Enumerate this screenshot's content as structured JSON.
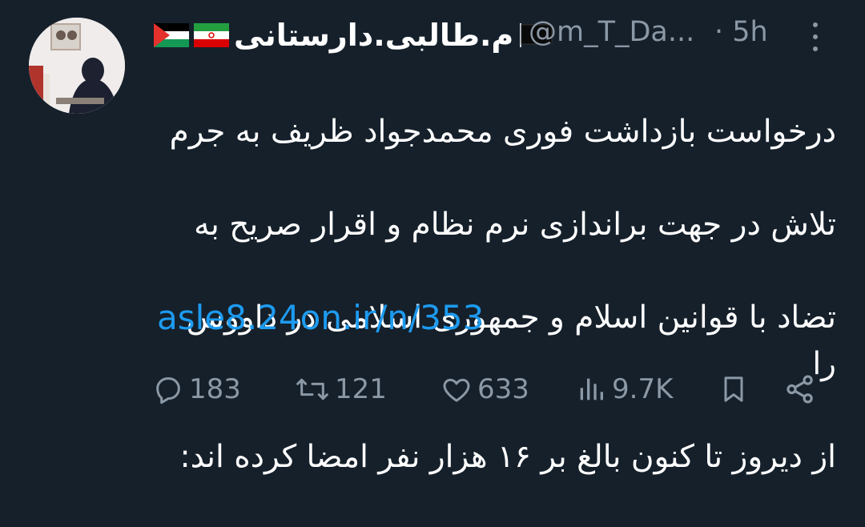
{
  "tweet": {
    "display_name": "م.طالبی.دارستانی",
    "handle": "@m_T_Da...",
    "time": "· 5h",
    "text_lines": [
      "درخواست بازداشت فوری محمدجواد ظریف به جرم",
      "تلاش در جهت براندازی نرم نظام و اقرار صریح به",
      "تضاد با قوانین اسلام و جمهوری اسلامی در داووس را",
      "از دیروز تا کنون بالغ بر ۱۶ هزار نفر امضا کرده اند:"
    ],
    "link": "asle8.24on.ir/n/353"
  },
  "actions": {
    "replies": "183",
    "retweets": "121",
    "likes": "633",
    "views": "9.7K"
  },
  "icons": {
    "reply": "reply-icon",
    "retweet": "retweet-icon",
    "like": "heart-icon",
    "views": "views-icon",
    "bookmark": "bookmark-icon",
    "share": "share-icon",
    "more": "more-options-icon",
    "flags": [
      "palestine-flag-icon",
      "iran-flag-icon",
      "black-flag-icon"
    ]
  },
  "colors": {
    "background": "#15202b",
    "text": "#ffffff",
    "muted": "#8b98a5",
    "link": "#1d9bf0"
  }
}
